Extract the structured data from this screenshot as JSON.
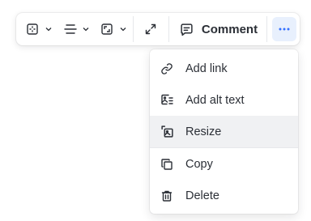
{
  "toolbar": {
    "comment_label": "Comment"
  },
  "menu": {
    "items": [
      {
        "label": "Add link",
        "icon": "link-icon"
      },
      {
        "label": "Add alt text",
        "icon": "alt-text-icon"
      },
      {
        "label": "Resize",
        "icon": "resize-icon"
      },
      {
        "label": "Copy",
        "icon": "copy-icon"
      },
      {
        "label": "Delete",
        "icon": "trash-icon"
      }
    ]
  },
  "colors": {
    "accent": "#3370ff",
    "active_bg": "#e8f0fd",
    "hover_bg": "#f0f1f3"
  }
}
